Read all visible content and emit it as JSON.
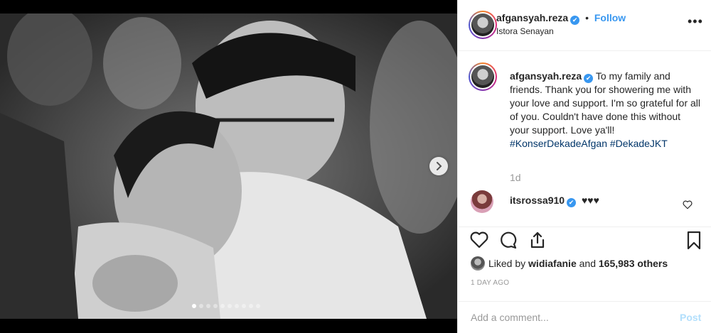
{
  "post": {
    "username": "afgansyah.reza",
    "verified_mark": "✔",
    "follow_separator": "•",
    "follow_label": "Follow",
    "location": "Istora Senayan",
    "more_label": "•••"
  },
  "caption": {
    "username": "afgansyah.reza",
    "text": "To my family and friends. Thank you for showering me with your love and support. I'm so grateful for all of you. Couldn't have done this without your support. Love ya'll!",
    "hashtags": [
      "#KonserDekadeAfgan",
      "#DekadeJKT"
    ],
    "time": "1d"
  },
  "comment": {
    "username": "itsrossa910",
    "text": "♥♥♥"
  },
  "likes": {
    "prefix": "Liked by",
    "user": "widiafanie",
    "connector": "and",
    "others": "165,983 others"
  },
  "timestamp": "1 DAY AGO",
  "add_comment": {
    "placeholder": "Add a comment...",
    "post_label": "Post"
  },
  "carousel": {
    "total": 10,
    "active_index": 0
  },
  "icons": {
    "like": "heart-icon",
    "comment": "comment-icon",
    "share": "share-icon",
    "save": "bookmark-icon",
    "more": "more-options-icon",
    "next": "chevron-right-icon"
  },
  "colors": {
    "link": "#3897f0",
    "hashtag": "#003569",
    "muted": "#999999",
    "post_disabled": "#b2dffc"
  }
}
